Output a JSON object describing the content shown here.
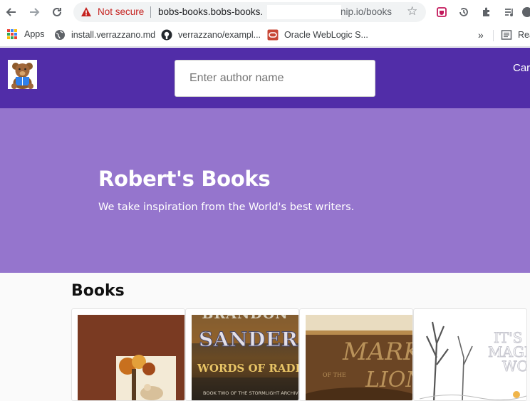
{
  "browser": {
    "security_label": "Not secure",
    "url_host": "bobs-books.bobs-books.",
    "url_tail": "nip.io/books",
    "colors": {
      "warning": "#c5221f"
    }
  },
  "bookmarks": [
    {
      "label": "Apps",
      "icon": "apps-grid-icon"
    },
    {
      "label": "install.verrazzano.md",
      "icon": "globe-icon"
    },
    {
      "label": "verrazzano/exampl...",
      "icon": "github-icon"
    },
    {
      "label": "Oracle WebLogic S...",
      "icon": "oracle-icon"
    },
    {
      "label": "»",
      "icon": "more-bookmarks-icon"
    },
    {
      "label": "Rea",
      "icon": "reading-list-icon"
    }
  ],
  "app": {
    "colors": {
      "navbar": "#512da8",
      "hero": "#9575cd"
    },
    "search": {
      "placeholder": "Enter author name",
      "value": ""
    },
    "nav_link": "Car",
    "hero": {
      "title": "Robert's Books",
      "subtitle": "We take inspiration from the World's best writers."
    },
    "section_title": "Books",
    "book_covers": [
      {
        "text": []
      },
      {
        "text": [
          "BRANDON",
          "SANDERSO",
          "WORDS OF RADIA",
          "BOOK TWO OF THE STORMLIGHT ARCHIVE"
        ]
      },
      {
        "text": [
          "MARK",
          "OF THE",
          "LION"
        ]
      },
      {
        "text": [
          "IT'S",
          "MAGIC",
          "WO"
        ]
      }
    ]
  }
}
